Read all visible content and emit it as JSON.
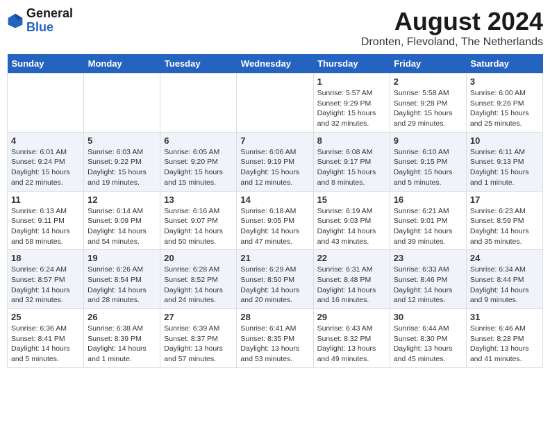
{
  "header": {
    "logo_line1": "General",
    "logo_line2": "Blue",
    "title": "August 2024",
    "location": "Dronten, Flevoland, The Netherlands"
  },
  "days_of_week": [
    "Sunday",
    "Monday",
    "Tuesday",
    "Wednesday",
    "Thursday",
    "Friday",
    "Saturday"
  ],
  "weeks": [
    [
      {
        "day": "",
        "content": ""
      },
      {
        "day": "",
        "content": ""
      },
      {
        "day": "",
        "content": ""
      },
      {
        "day": "",
        "content": ""
      },
      {
        "day": "1",
        "content": "Sunrise: 5:57 AM\nSunset: 9:29 PM\nDaylight: 15 hours\nand 32 minutes."
      },
      {
        "day": "2",
        "content": "Sunrise: 5:58 AM\nSunset: 9:28 PM\nDaylight: 15 hours\nand 29 minutes."
      },
      {
        "day": "3",
        "content": "Sunrise: 6:00 AM\nSunset: 9:26 PM\nDaylight: 15 hours\nand 25 minutes."
      }
    ],
    [
      {
        "day": "4",
        "content": "Sunrise: 6:01 AM\nSunset: 9:24 PM\nDaylight: 15 hours\nand 22 minutes."
      },
      {
        "day": "5",
        "content": "Sunrise: 6:03 AM\nSunset: 9:22 PM\nDaylight: 15 hours\nand 19 minutes."
      },
      {
        "day": "6",
        "content": "Sunrise: 6:05 AM\nSunset: 9:20 PM\nDaylight: 15 hours\nand 15 minutes."
      },
      {
        "day": "7",
        "content": "Sunrise: 6:06 AM\nSunset: 9:19 PM\nDaylight: 15 hours\nand 12 minutes."
      },
      {
        "day": "8",
        "content": "Sunrise: 6:08 AM\nSunset: 9:17 PM\nDaylight: 15 hours\nand 8 minutes."
      },
      {
        "day": "9",
        "content": "Sunrise: 6:10 AM\nSunset: 9:15 PM\nDaylight: 15 hours\nand 5 minutes."
      },
      {
        "day": "10",
        "content": "Sunrise: 6:11 AM\nSunset: 9:13 PM\nDaylight: 15 hours\nand 1 minute."
      }
    ],
    [
      {
        "day": "11",
        "content": "Sunrise: 6:13 AM\nSunset: 9:11 PM\nDaylight: 14 hours\nand 58 minutes."
      },
      {
        "day": "12",
        "content": "Sunrise: 6:14 AM\nSunset: 9:09 PM\nDaylight: 14 hours\nand 54 minutes."
      },
      {
        "day": "13",
        "content": "Sunrise: 6:16 AM\nSunset: 9:07 PM\nDaylight: 14 hours\nand 50 minutes."
      },
      {
        "day": "14",
        "content": "Sunrise: 6:18 AM\nSunset: 9:05 PM\nDaylight: 14 hours\nand 47 minutes."
      },
      {
        "day": "15",
        "content": "Sunrise: 6:19 AM\nSunset: 9:03 PM\nDaylight: 14 hours\nand 43 minutes."
      },
      {
        "day": "16",
        "content": "Sunrise: 6:21 AM\nSunset: 9:01 PM\nDaylight: 14 hours\nand 39 minutes."
      },
      {
        "day": "17",
        "content": "Sunrise: 6:23 AM\nSunset: 8:59 PM\nDaylight: 14 hours\nand 35 minutes."
      }
    ],
    [
      {
        "day": "18",
        "content": "Sunrise: 6:24 AM\nSunset: 8:57 PM\nDaylight: 14 hours\nand 32 minutes."
      },
      {
        "day": "19",
        "content": "Sunrise: 6:26 AM\nSunset: 8:54 PM\nDaylight: 14 hours\nand 28 minutes."
      },
      {
        "day": "20",
        "content": "Sunrise: 6:28 AM\nSunset: 8:52 PM\nDaylight: 14 hours\nand 24 minutes."
      },
      {
        "day": "21",
        "content": "Sunrise: 6:29 AM\nSunset: 8:50 PM\nDaylight: 14 hours\nand 20 minutes."
      },
      {
        "day": "22",
        "content": "Sunrise: 6:31 AM\nSunset: 8:48 PM\nDaylight: 14 hours\nand 16 minutes."
      },
      {
        "day": "23",
        "content": "Sunrise: 6:33 AM\nSunset: 8:46 PM\nDaylight: 14 hours\nand 12 minutes."
      },
      {
        "day": "24",
        "content": "Sunrise: 6:34 AM\nSunset: 8:44 PM\nDaylight: 14 hours\nand 9 minutes."
      }
    ],
    [
      {
        "day": "25",
        "content": "Sunrise: 6:36 AM\nSunset: 8:41 PM\nDaylight: 14 hours\nand 5 minutes."
      },
      {
        "day": "26",
        "content": "Sunrise: 6:38 AM\nSunset: 8:39 PM\nDaylight: 14 hours\nand 1 minute."
      },
      {
        "day": "27",
        "content": "Sunrise: 6:39 AM\nSunset: 8:37 PM\nDaylight: 13 hours\nand 57 minutes."
      },
      {
        "day": "28",
        "content": "Sunrise: 6:41 AM\nSunset: 8:35 PM\nDaylight: 13 hours\nand 53 minutes."
      },
      {
        "day": "29",
        "content": "Sunrise: 6:43 AM\nSunset: 8:32 PM\nDaylight: 13 hours\nand 49 minutes."
      },
      {
        "day": "30",
        "content": "Sunrise: 6:44 AM\nSunset: 8:30 PM\nDaylight: 13 hours\nand 45 minutes."
      },
      {
        "day": "31",
        "content": "Sunrise: 6:46 AM\nSunset: 8:28 PM\nDaylight: 13 hours\nand 41 minutes."
      }
    ]
  ]
}
